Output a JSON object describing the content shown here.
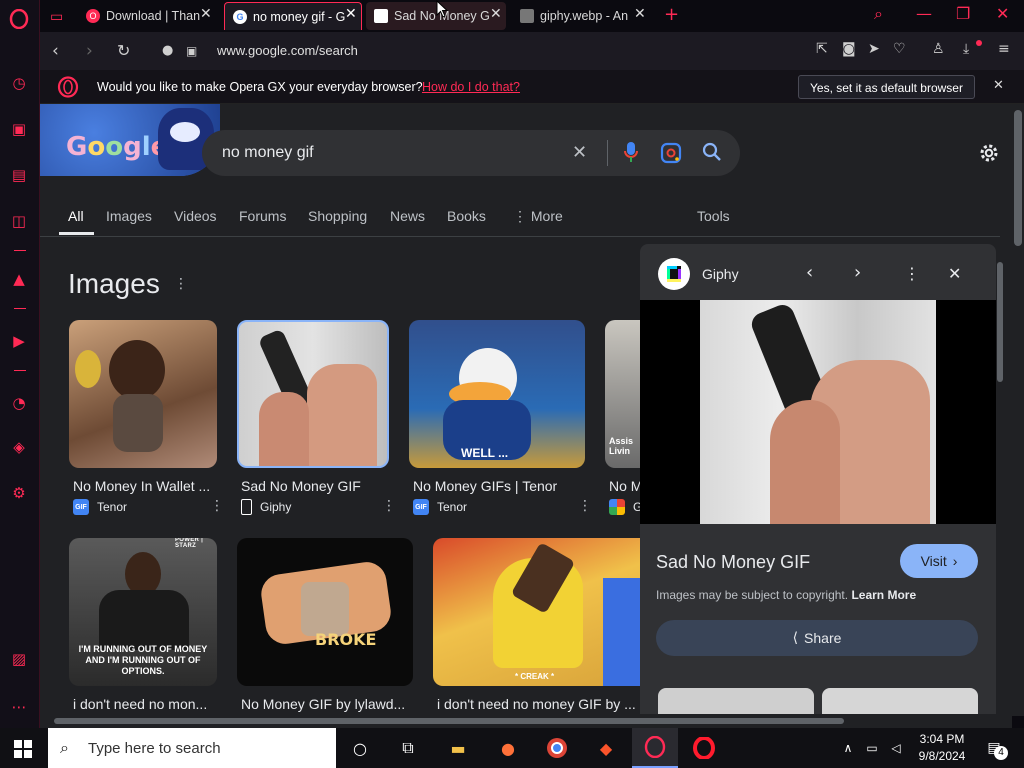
{
  "tabs": [
    {
      "title": "Download | Than",
      "active": false
    },
    {
      "title": "no money gif - G",
      "active": true
    },
    {
      "title": "Sad No Money G",
      "active": false
    },
    {
      "title": "giphy.webp - An",
      "active": false
    }
  ],
  "address": {
    "url": "www.google.com/search"
  },
  "notification": {
    "message": "Would you like to make Opera GX your everyday browser?",
    "link": "How do I do that?",
    "button": "Yes, set it as default browser"
  },
  "search": {
    "query": "no money gif"
  },
  "google_tabs": [
    "All",
    "Images",
    "Videos",
    "Forums",
    "Shopping",
    "News",
    "Books",
    "More",
    "Tools"
  ],
  "images_heading": "Images",
  "results_row1": [
    {
      "caption": "No Money In Wallet ...",
      "source": "Tenor",
      "source_icon": "GIF"
    },
    {
      "caption": "Sad No Money GIF",
      "source": "Giphy",
      "source_icon": "giphy"
    },
    {
      "caption": "No Money GIFs | Tenor",
      "source": "Tenor",
      "source_icon": "GIF"
    },
    {
      "caption": "No M",
      "source": "G",
      "source_icon": "multi"
    }
  ],
  "results_row2": [
    {
      "caption": "i don't need no mon..."
    },
    {
      "caption": "No Money GIF by lylawd..."
    },
    {
      "caption": "i don't need no money GIF by ..."
    }
  ],
  "thumb_texts": {
    "donald": "WELL ...",
    "suit_text": "I'M RUNNING OUT OF MONEY AND I'M RUNNING OUT OF OPTIONS.",
    "suit_badge": "POWER | STARZ",
    "broke": "BROKE",
    "cartoon": "* CREAK *",
    "assist": "Assis\nLivin"
  },
  "panel": {
    "site": "Giphy",
    "title": "Sad No Money GIF",
    "visit": "Visit",
    "copyright": "Images may be subject to copyright.",
    "learn_more": "Learn More",
    "share": "Share"
  },
  "taskbar": {
    "search_placeholder": "Type here to search",
    "time": "3:04 PM",
    "date": "9/8/2024",
    "notifications": "4"
  },
  "colors": {
    "opera_red": "#ff2a55",
    "google_bg": "#202124",
    "panel_bg": "#303134",
    "visit_blue": "#8ab4f8"
  }
}
